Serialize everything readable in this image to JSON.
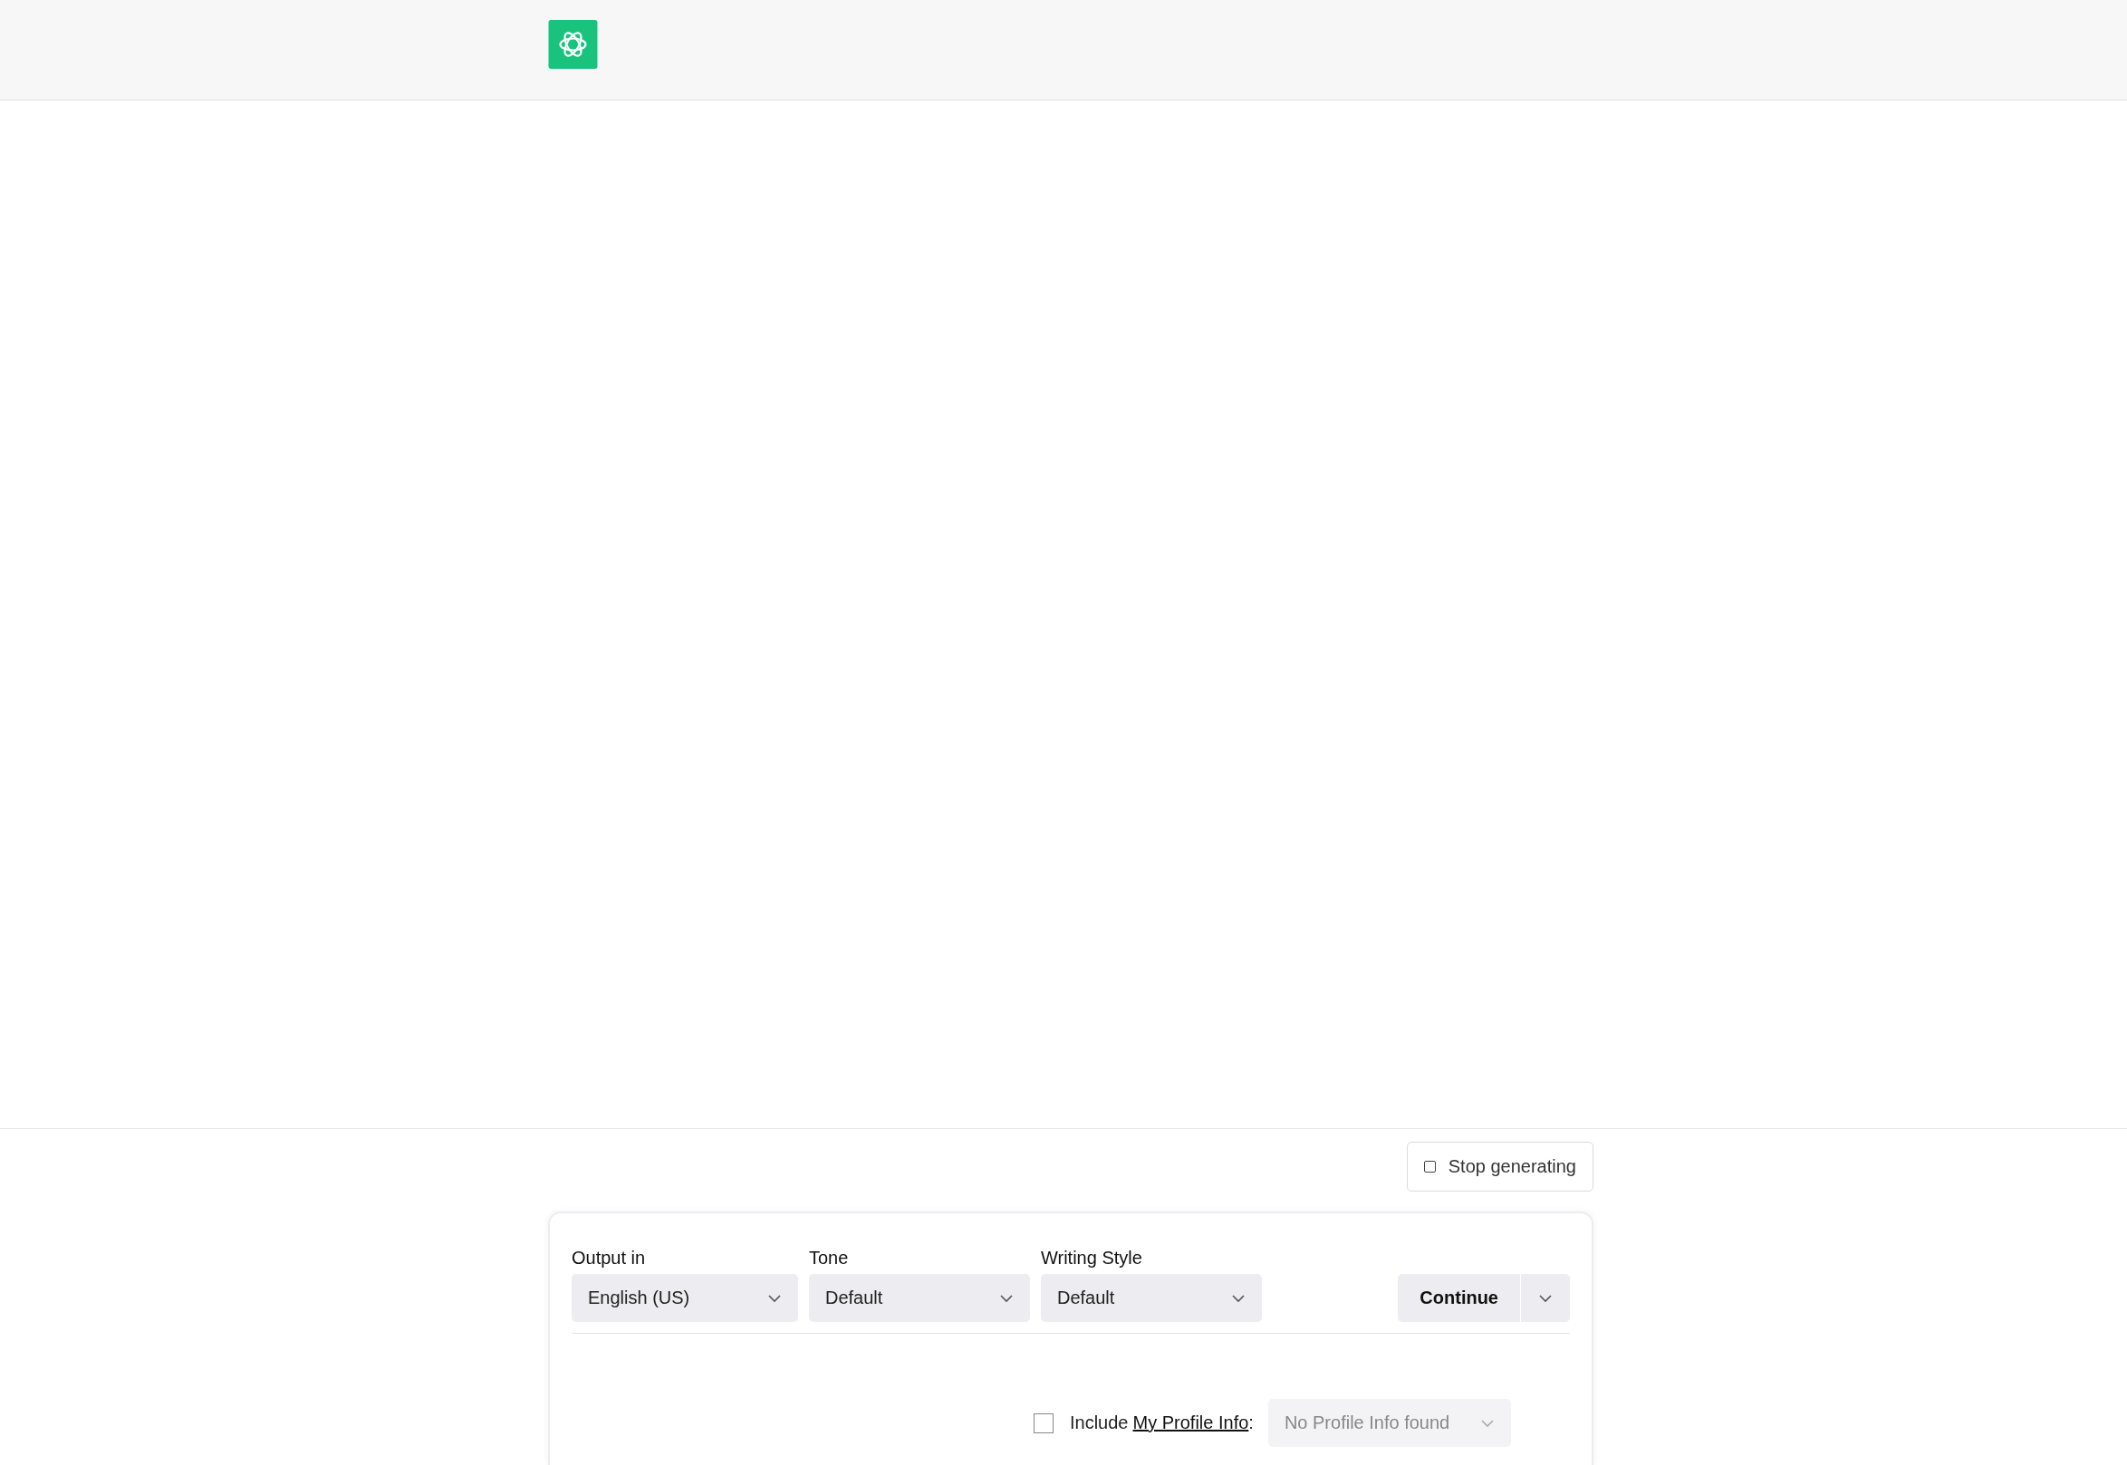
{
  "stop_button": {
    "label": "Stop generating"
  },
  "options": [
    {
      "label": "Output in",
      "value": "English (US)"
    },
    {
      "label": "Tone",
      "value": "Default"
    },
    {
      "label": "Writing Style",
      "value": "Default"
    }
  ],
  "continue_button": {
    "label": "Continue"
  },
  "profile": {
    "checked": false,
    "text": "Include",
    "link": "My Profile Info",
    "suffix": ":",
    "select": {
      "value": "No Profile Info found",
      "disabled": true
    }
  }
}
